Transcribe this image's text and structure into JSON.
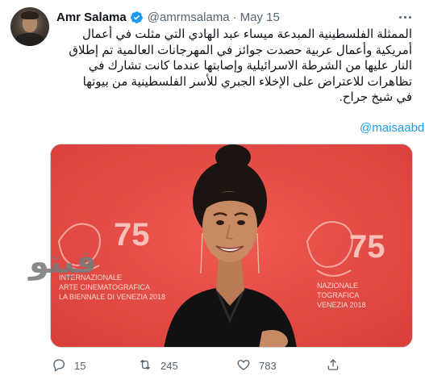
{
  "tweet": {
    "author_name": "Amr Salama",
    "handle": "@amrmsalama",
    "separator": "·",
    "date": "May 15",
    "verified": true,
    "lines": [
      "الممثلة الفلسطينية المبدعة ميساء عبد الهادي التي مثلت في أعمال",
      "أمريكية وأعمال عربية حصدت جوائز في المهرجانات العالمية تم إطلاق",
      "النار عليها من الشرطة الاسرائيلية وإصابتها عندما كانت تشارك في",
      "تظاهرات للاعتراض على الإخلاء الجبري للأسر الفلسطينية من بيوتها",
      "في شيخ جراح."
    ],
    "mention": "@maisaabd"
  },
  "media": {
    "backdrop_color": "#e84b45",
    "backdrop_text_left": [
      "INTERNAZIONALE",
      "ARTE CINEMATOGRAFICA",
      "LA BIENNALE DI VENEZIA 2018"
    ],
    "backdrop_text_right": [
      "75",
      "NAZIONALE",
      "TOGRAFICA",
      "VENEZIA 2018"
    ],
    "backdrop_numeral": "75",
    "watermark": "فيتو"
  },
  "actions": {
    "replies": "15",
    "retweets": "245",
    "likes": "783"
  },
  "icons": {
    "more": "more-icon",
    "verified": "verified-badge-icon",
    "reply": "reply-icon",
    "retweet": "retweet-icon",
    "like": "like-icon",
    "share": "share-icon"
  },
  "colors": {
    "accent": "#1d9bf0",
    "secondary_text": "#536471",
    "primary_text": "#0f1419"
  }
}
